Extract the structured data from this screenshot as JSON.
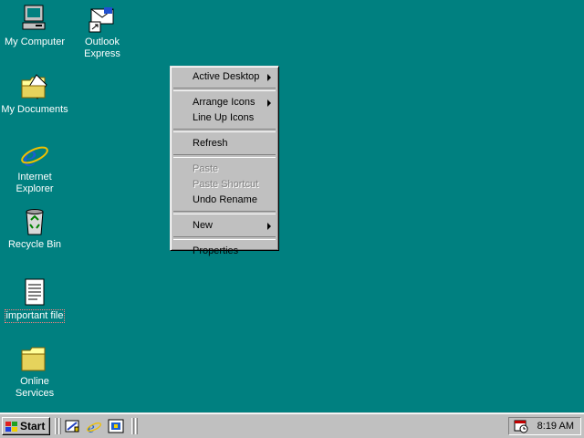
{
  "desktop": {
    "icons": [
      {
        "label": "My Computer"
      },
      {
        "label": "Outlook Express"
      },
      {
        "label": "My Documents"
      },
      {
        "label": "Internet Explorer"
      },
      {
        "label": "Recycle Bin"
      },
      {
        "label": "important file"
      },
      {
        "label": "Online Services"
      }
    ],
    "background_color": "#008080"
  },
  "context_menu": {
    "items": [
      {
        "label": "Active Desktop",
        "submenu": true,
        "enabled": true
      },
      {
        "label": "Arrange Icons",
        "submenu": true,
        "enabled": true
      },
      {
        "label": "Line Up Icons",
        "submenu": false,
        "enabled": true
      },
      {
        "label": "Refresh",
        "submenu": false,
        "enabled": true
      },
      {
        "label": "Paste",
        "submenu": false,
        "enabled": false
      },
      {
        "label": "Paste Shortcut",
        "submenu": false,
        "enabled": false
      },
      {
        "label": "Undo Rename",
        "submenu": false,
        "enabled": true
      },
      {
        "label": "New",
        "submenu": true,
        "enabled": true
      },
      {
        "label": "Properties",
        "submenu": false,
        "enabled": true
      }
    ]
  },
  "taskbar": {
    "start_label": "Start",
    "quick_launch": [
      "show-desktop-icon",
      "internet-explorer-icon",
      "channels-icon"
    ],
    "clock": "8:19 AM"
  }
}
